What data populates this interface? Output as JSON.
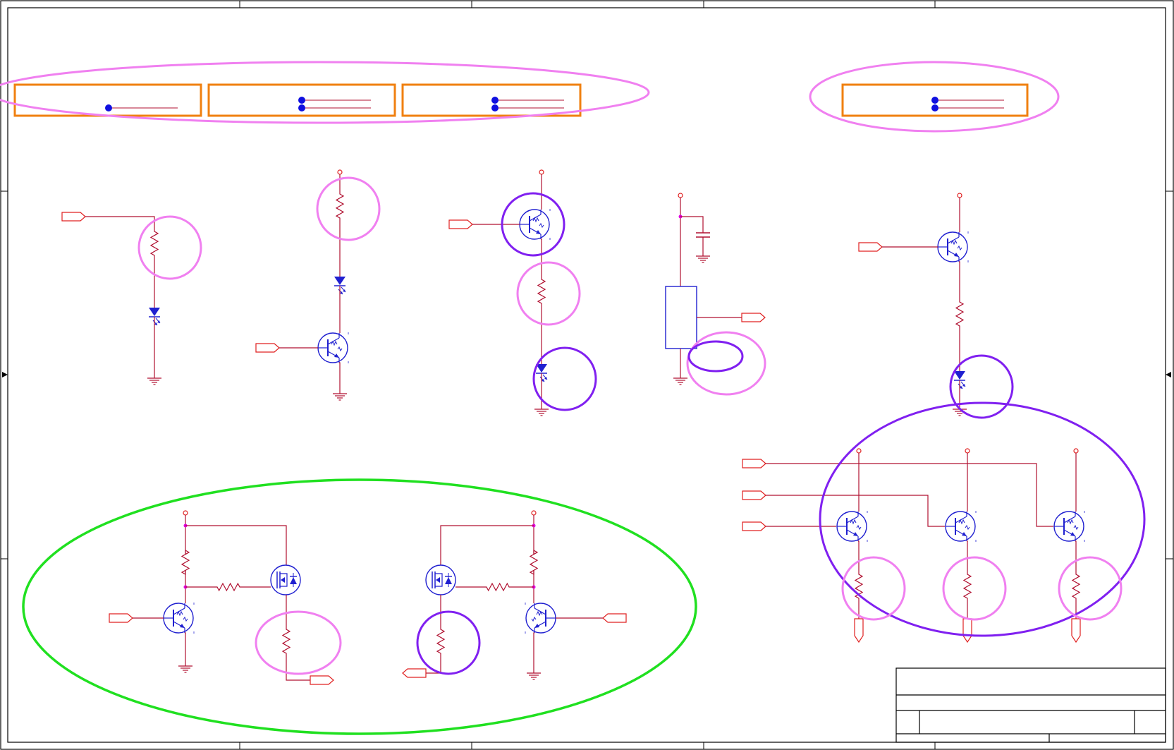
{
  "colors": {
    "wire": "#b01030",
    "symbol": "#2020d0",
    "port": "#e02020",
    "junction": "#e000e0",
    "connector_box": "#f08010",
    "note_pink": "#f080f0",
    "note_purple": "#8020f0",
    "note_green": "#20e020",
    "frame": "#000000",
    "pin_dot": "#1010e0"
  },
  "frame": {
    "border": "double",
    "zones": "unlabeled"
  },
  "title_block": {
    "fields": "blank"
  },
  "elements": "unlabeled"
}
